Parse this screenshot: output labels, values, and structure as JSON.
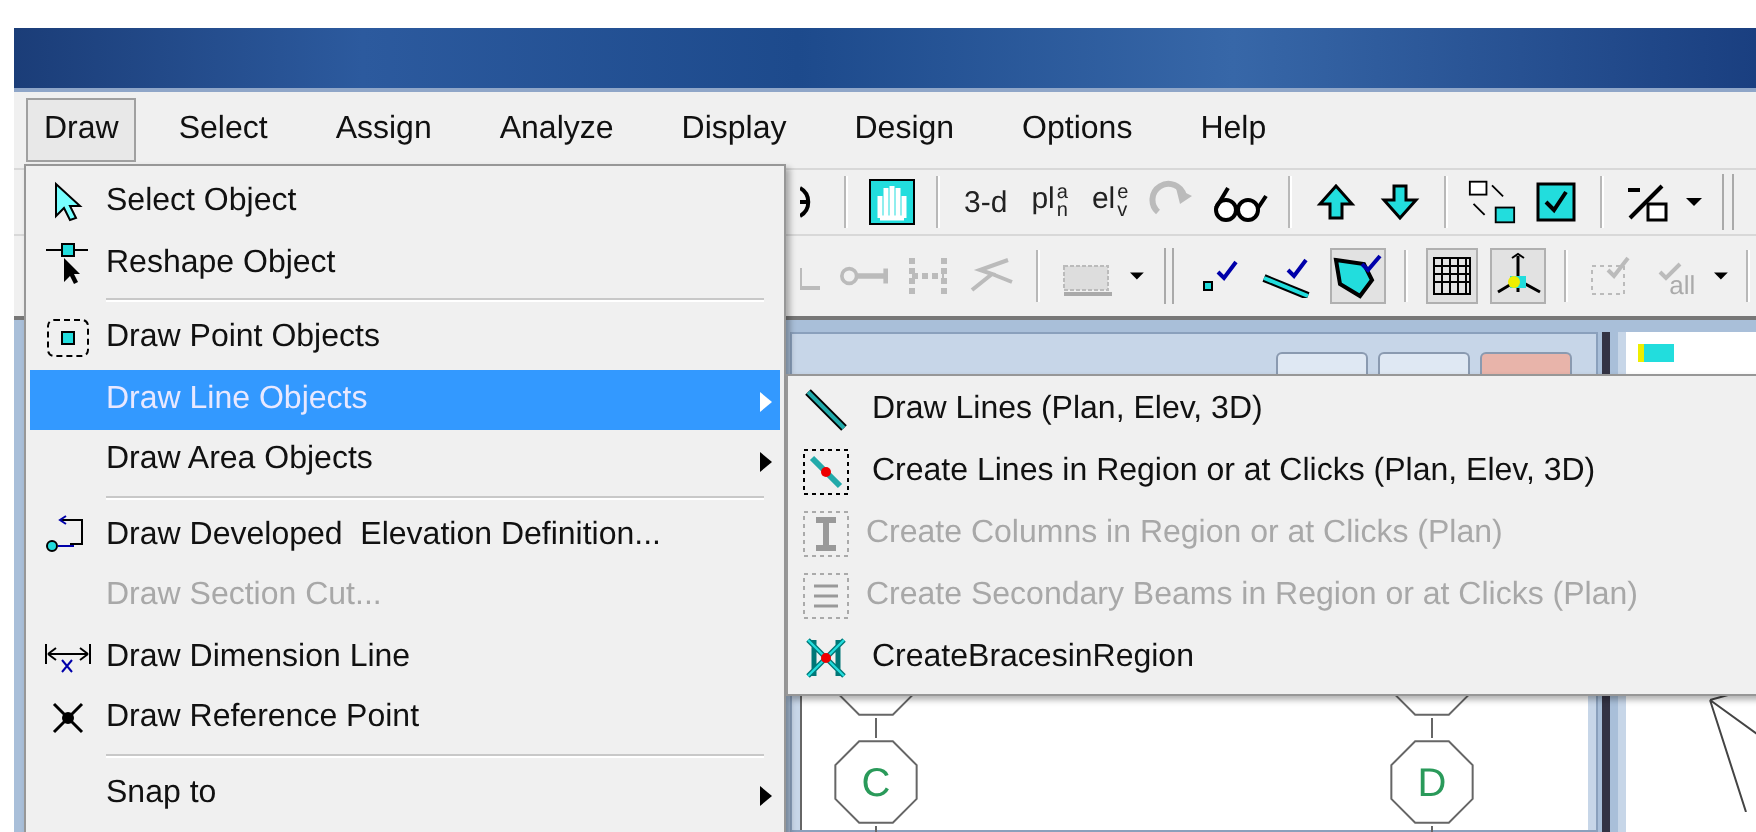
{
  "menu_bar": [
    {
      "label": "Draw",
      "selected": true
    },
    {
      "label": "Select",
      "selected": false
    },
    {
      "label": "Assign",
      "selected": false
    },
    {
      "label": "Analyze",
      "selected": false
    },
    {
      "label": "Display",
      "selected": false
    },
    {
      "label": "Design",
      "selected": false
    },
    {
      "label": "Options",
      "selected": false
    },
    {
      "label": "Help",
      "selected": false
    }
  ],
  "toolbar_1": {
    "view_buttons": [
      "3-d",
      "plan",
      "elev"
    ]
  },
  "toolbar_2": {
    "snap_buttons": [
      {
        "selected": false
      },
      {
        "selected": false
      },
      {
        "selected": true
      }
    ],
    "view_toggles": [
      {
        "selected": true
      },
      {
        "selected": true
      }
    ],
    "select_all_label": "all"
  },
  "draw_menu": [
    {
      "kind": "item",
      "label": "Select Object",
      "disabled": false,
      "selected": false,
      "has_submenu": false
    },
    {
      "kind": "item",
      "label": "Reshape Object",
      "disabled": false,
      "selected": false,
      "has_submenu": false
    },
    {
      "kind": "separator"
    },
    {
      "kind": "item",
      "label": "Draw Point Objects",
      "disabled": false,
      "selected": false,
      "has_submenu": false
    },
    {
      "kind": "item",
      "label": "Draw Line Objects",
      "disabled": false,
      "selected": true,
      "has_submenu": true
    },
    {
      "kind": "item",
      "label": "Draw Area Objects",
      "disabled": false,
      "selected": false,
      "has_submenu": true
    },
    {
      "kind": "separator"
    },
    {
      "kind": "item",
      "label": "Draw Developed  Elevation Definition...",
      "disabled": false,
      "selected": false,
      "has_submenu": false
    },
    {
      "kind": "item",
      "label": "Draw Section Cut...",
      "disabled": true,
      "selected": false,
      "has_submenu": false
    },
    {
      "kind": "item",
      "label": "Draw Dimension Line",
      "disabled": false,
      "selected": false,
      "has_submenu": false
    },
    {
      "kind": "item",
      "label": "Draw Reference Point",
      "disabled": false,
      "selected": false,
      "has_submenu": false
    },
    {
      "kind": "separator"
    },
    {
      "kind": "item",
      "label": "Snap to",
      "disabled": false,
      "selected": false,
      "has_submenu": true
    }
  ],
  "line_objects_submenu": [
    {
      "label": "Draw Lines (Plan, Elev, 3D)",
      "disabled": false
    },
    {
      "label": "Create Lines in Region or at Clicks (Plan, Elev, 3D)",
      "disabled": false
    },
    {
      "label": "Create Columns in Region or at Clicks (Plan)",
      "disabled": true
    },
    {
      "label": "Create Secondary Beams in Region or at Clicks (Plan)",
      "disabled": true
    },
    {
      "label": "CreateBracesinRegion",
      "disabled": false
    }
  ],
  "canvas": {
    "grid_bubbles": [
      "C",
      "D"
    ]
  }
}
